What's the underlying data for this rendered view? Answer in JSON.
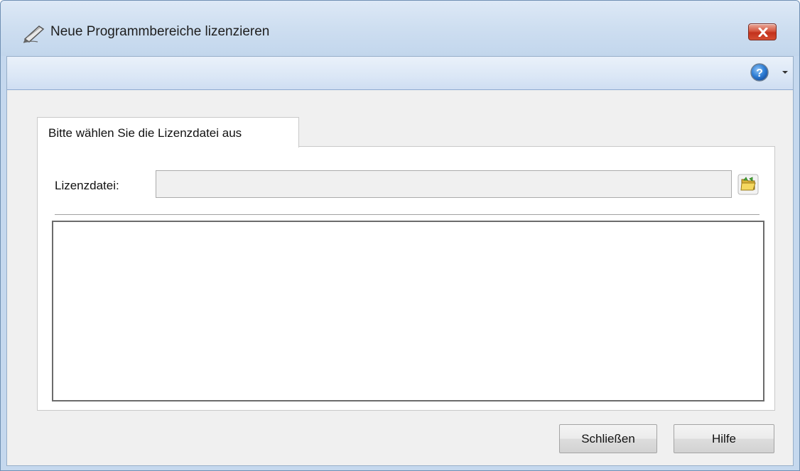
{
  "window": {
    "title": "Neue Programmbereiche lizenzieren",
    "title_icon": "pen-edit-icon",
    "close_icon": "close-icon"
  },
  "toolbar": {
    "help_icon": "help-icon",
    "dropdown_icon": "chevron-down-icon"
  },
  "tab": {
    "label": "Bitte wählen Sie die Lizenzdatei aus"
  },
  "form": {
    "license_label": "Lizenzdatei:",
    "license_value": "",
    "browse_icon": "folder-open-icon",
    "output_text": ""
  },
  "buttons": {
    "close_label": "Schließen",
    "help_label": "Hilfe"
  },
  "colors": {
    "title_gradient": "#cfdff1",
    "close_red": "#c3321c",
    "dialog_bg": "#f0f0f0",
    "toolbar_border": "#8eaad0"
  }
}
